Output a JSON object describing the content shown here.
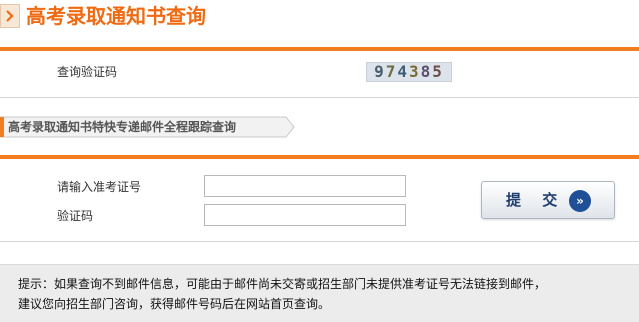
{
  "header": {
    "title": "高考录取通知书查询"
  },
  "verify_code": {
    "label": "查询验证码",
    "chars": [
      "9",
      "7",
      "4",
      "3",
      "8",
      "5"
    ]
  },
  "section": {
    "title": "高考录取通知书特快专递邮件全程跟踪查询"
  },
  "form": {
    "exam_no_label": "请输入准考证号",
    "exam_no_value": "",
    "code_label": "验证码",
    "code_value": "",
    "submit_label": "提 交",
    "submit_icon": "double-chevron-right-icon"
  },
  "notice": {
    "line1": "提示：如果查询不到邮件信息，可能由于邮件尚未交寄或招生部门未提供准考证号无法链接到邮件，",
    "line2": "建议您向招生部门咨询，获得邮件号码后在网站首页查询。"
  },
  "colors": {
    "accent": "#f47c20",
    "title": "#f06a12",
    "button_icon": "#1f4f96"
  }
}
